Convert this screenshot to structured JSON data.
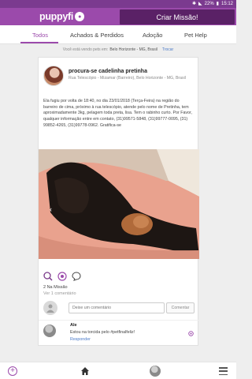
{
  "status_bar": {
    "battery": "22%",
    "time": "15:12"
  },
  "header": {
    "logo_text": "puppyfi",
    "create_button": "Criar Missão!"
  },
  "tabs": [
    {
      "label": "Todos",
      "active": true
    },
    {
      "label": "Achados & Perdidos",
      "active": false
    },
    {
      "label": "Adoção",
      "active": false
    },
    {
      "label": "Pet Help",
      "active": false
    }
  ],
  "location": {
    "prefix": "Você está vendo pets em:",
    "city": "Belo Horizonte - MG, Brasil",
    "change": "Trocar"
  },
  "post": {
    "title": "procura-se cadelinha pretinha",
    "address": "Rua Telescópio - Mizamar (Barreiro), Belo Horizonte - MG, Brasil",
    "text": "Ela fugiu por volta de 18:40, no dia 23/01/2018 (Terça-Feira) na região do barreiro de cima, próximo à rua telescópio, atende pelo nome de Pretinha, tem aproximadamente 3kg, pelagem toda preta, lisa. Tem o rabinho curto. Por Favor, qualquer informação entre em contato, (31)99571-5848, (31)99777-0095, (31) 99852-4265, (31)99778-0962. Gratifica-se",
    "mission_count": "2 Na Missão",
    "view_comments": "Ver 1 comentário",
    "comment_placeholder": "Deixe um comentário",
    "comment_button": "Comentar"
  },
  "reply": {
    "author": "Ale",
    "text": "Estou na torcida pelo #petfinalfeliz!",
    "link": "Responder"
  },
  "colors": {
    "brand": "#9b4aab",
    "brand_dark": "#5a2166",
    "link": "#4a7ac8"
  },
  "icons": [
    "search-icon",
    "mission-icon",
    "comment-icon",
    "add-icon",
    "home-icon",
    "menu-icon"
  ]
}
